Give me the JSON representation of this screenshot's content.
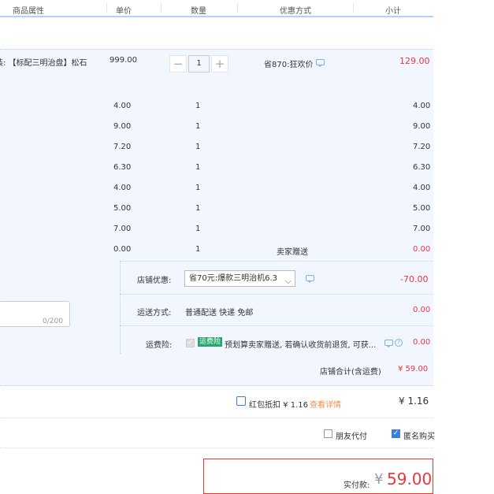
{
  "header": {
    "col_attr": "商品属性",
    "col_price": "单价",
    "col_qty": "数量",
    "col_discount": "优惠方式",
    "col_subtotal": "小计"
  },
  "main_item": {
    "name_fragment": "装: 【标配三明治盘】松石",
    "price": "999.00",
    "qty_minus": "−",
    "qty": "1",
    "qty_plus": "+",
    "discount": "省870:狂欢价",
    "subtotal": "129.00"
  },
  "sub_items": [
    {
      "price": "4.00",
      "qty": "1",
      "subtotal": "4.00"
    },
    {
      "price": "9.00",
      "qty": "1",
      "subtotal": "9.00"
    },
    {
      "price": "7.20",
      "qty": "1",
      "subtotal": "7.20"
    },
    {
      "price": "6.30",
      "qty": "1",
      "subtotal": "6.30"
    },
    {
      "price": "4.00",
      "qty": "1",
      "subtotal": "4.00"
    },
    {
      "price": "5.00",
      "qty": "1",
      "subtotal": "5.00"
    },
    {
      "price": "7.00",
      "qty": "1",
      "subtotal": "7.00"
    },
    {
      "price": "0.00",
      "qty": "1",
      "discount": "卖家赠送",
      "subtotal": "0.00"
    }
  ],
  "shop": {
    "discount_label": "店铺优惠:",
    "discount_select": "省70元:爆款三明治机6.3",
    "discount_value": "-70.00",
    "shipping_label": "运送方式:",
    "shipping_value": "普通配送 快递 免邮",
    "shipping_price": "0.00",
    "insurance_label": "运费险:",
    "insurance_tag": "运费险",
    "insurance_text": "预划算卖家赠送, 若确认收货前退货, 可获...",
    "insurance_price": "0.00",
    "message_counter": "0/200",
    "total_label": "店铺合计(含运费)",
    "total_value": "¥ 59.00"
  },
  "redpacket": {
    "label": "红包抵扣 ¥ 1.16",
    "link": "查看详情",
    "value": "¥ 1.16"
  },
  "options": {
    "friend_pay": "朋友代付",
    "anonymous": "匿名购买"
  },
  "payment": {
    "label": "实付款:",
    "currency": "¥",
    "amount": "59.00"
  },
  "colors": {
    "accent_red": "#e4393c",
    "accent_blue": "#3f7de0",
    "band_blue": "#f2f7ff",
    "tag_green": "#27a56d"
  }
}
